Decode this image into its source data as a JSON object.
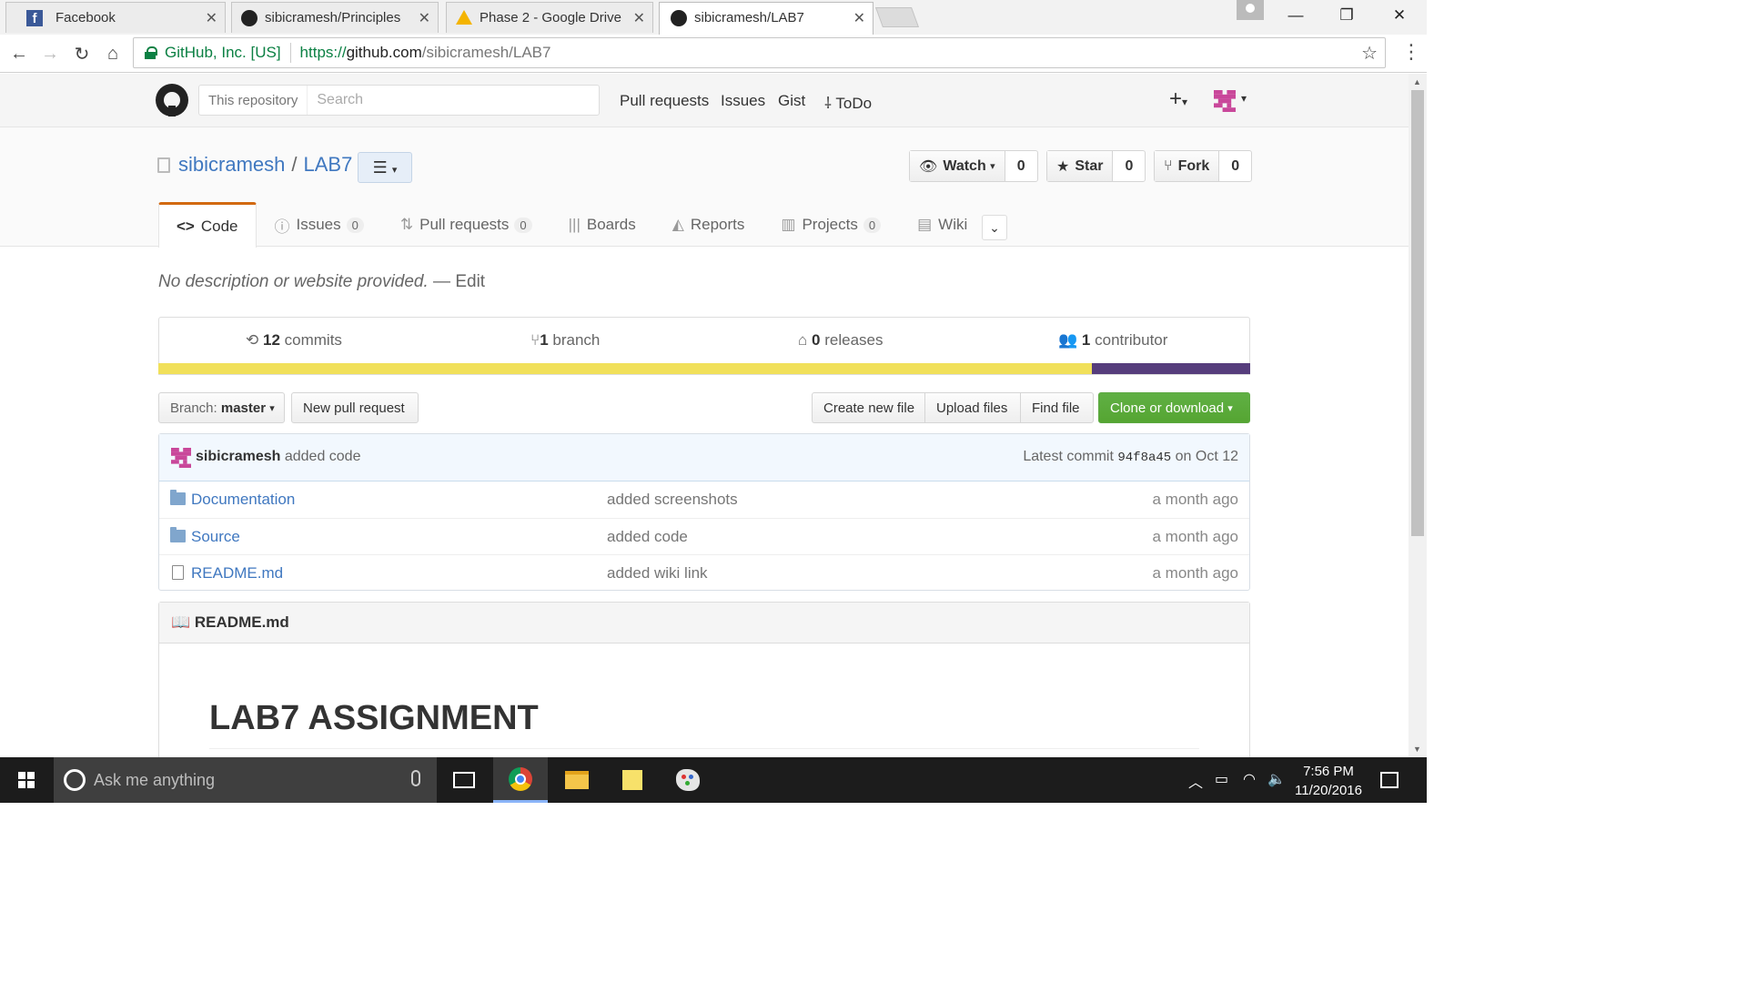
{
  "browser": {
    "tabs": [
      {
        "title": "Facebook",
        "icon": "facebook-icon"
      },
      {
        "title": "sibicramesh/Principles-of",
        "icon": "github-icon"
      },
      {
        "title": "Phase 2 - Google Drive",
        "icon": "google-drive-icon"
      },
      {
        "title": "sibicramesh/LAB7",
        "icon": "github-icon",
        "active": true
      }
    ],
    "address": {
      "ev_label": "GitHub, Inc. [US]",
      "scheme": "https://",
      "host": "github.com",
      "path": "/sibicramesh/LAB7"
    }
  },
  "gh_header": {
    "search_scope": "This repository",
    "search_placeholder": "Search",
    "nav": [
      "Pull requests",
      "Issues",
      "Gist",
      "ToDo"
    ]
  },
  "repo": {
    "owner": "sibicramesh",
    "name": "LAB7",
    "watch": {
      "label": "Watch",
      "count": "0"
    },
    "star": {
      "label": "Star",
      "count": "0"
    },
    "fork": {
      "label": "Fork",
      "count": "0"
    },
    "tabs": [
      {
        "label": "Code",
        "icon": "code-icon"
      },
      {
        "label": "Issues",
        "icon": "issue-icon",
        "count": "0"
      },
      {
        "label": "Pull requests",
        "icon": "pull-request-icon",
        "count": "0"
      },
      {
        "label": "Boards",
        "icon": "boards-icon"
      },
      {
        "label": "Reports",
        "icon": "reports-icon"
      },
      {
        "label": "Projects",
        "icon": "projects-icon",
        "count": "0"
      },
      {
        "label": "Wiki",
        "icon": "wiki-icon"
      }
    ],
    "description": "No description or website provided.",
    "edit_label": "— Edit",
    "summary": {
      "commits_n": "12",
      "commits_label": "commits",
      "branches_n": "1",
      "branches_label": "branch",
      "releases_n": "0",
      "releases_label": "releases",
      "contributors_n": "1",
      "contributors_label": "contributor"
    },
    "languages": [
      {
        "color": "#f1e05a",
        "share": 0.855
      },
      {
        "color": "#563d7c",
        "share": 0.145
      }
    ],
    "branch_label": "Branch:",
    "branch_value": "master",
    "new_pr": "New pull request",
    "create_file": "Create new file",
    "upload_files": "Upload files",
    "find_file": "Find file",
    "clone": "Clone or download",
    "latest_commit": {
      "author": "sibicramesh",
      "message": "added code",
      "prefix": "Latest commit",
      "sha": "94f8a45",
      "date": "on Oct 12"
    },
    "files": [
      {
        "name": "Documentation",
        "type": "folder",
        "message": "added screenshots",
        "age": "a month ago"
      },
      {
        "name": "Source",
        "type": "folder",
        "message": "added code",
        "age": "a month ago"
      },
      {
        "name": "README.md",
        "type": "file",
        "message": "added wiki link",
        "age": "a month ago"
      }
    ],
    "readme_title": "README.md",
    "readme_h1": "LAB7 ASSIGNMENT"
  },
  "taskbar": {
    "search_placeholder": "Ask me anything",
    "time": "7:56 PM",
    "date": "11/20/2016"
  }
}
